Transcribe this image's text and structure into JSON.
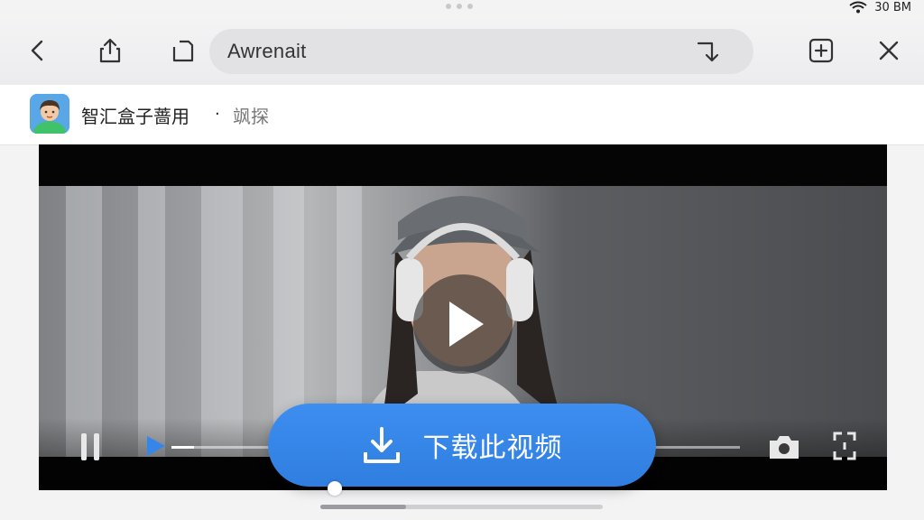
{
  "status": {
    "time": "30 BM",
    "wifi_icon": "wifi-icon",
    "signal_icon": "signal-icon"
  },
  "toolbar": {
    "back_icon": "chevron-left-icon",
    "share_icon": "share-icon",
    "reload_icon": "reload-icon",
    "url_text": "Awrenait",
    "go_icon": "arrow-turn-down-icon",
    "new_tab_icon": "plus-square-icon",
    "close_icon": "close-icon"
  },
  "channel": {
    "name": "智汇盒子蔷用",
    "separator": "·",
    "follow": "飒探"
  },
  "video": {
    "paused": true,
    "progress_fraction": 0.04,
    "pause_icon": "pause-icon",
    "play_icon": "play-icon",
    "fullscreen_icon": "fullscreen-icon",
    "camera_icon": "camera-icon"
  },
  "download": {
    "label": "下载此视频",
    "icon": "download-icon"
  },
  "colors": {
    "accent": "#3586EA",
    "toolbar": "#F1F1F2",
    "video_bg": "#050505"
  }
}
